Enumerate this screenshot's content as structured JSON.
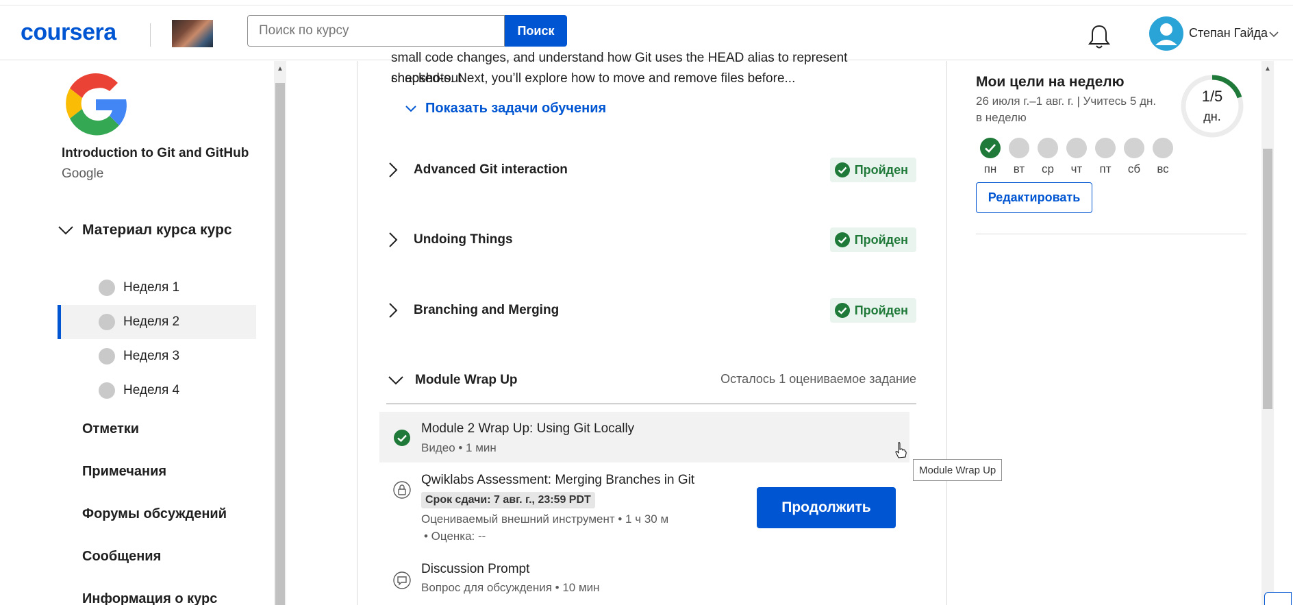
{
  "header": {
    "logo_text": "coursera",
    "search_placeholder": "Поиск по курсу",
    "search_button": "Поиск",
    "user_name": "Степан Гайда"
  },
  "sidebar": {
    "course_title": "Introduction to Git and GitHub",
    "course_org": "Google",
    "material_label": "Материал курса курс",
    "weeks": [
      {
        "label": "Неделя 1",
        "active": false
      },
      {
        "label": "Неделя 2",
        "active": true
      },
      {
        "label": "Неделя 3",
        "active": false
      },
      {
        "label": "Неделя 4",
        "active": false
      }
    ],
    "links": [
      "Отметки",
      "Примечания",
      "Форумы обсуждений",
      "Сообщения",
      "Информация о курс"
    ]
  },
  "main": {
    "cut_line1": "small code changes, and understand how Git uses the HEAD alias to represent checked-out",
    "cut_line2": "snapshots. Next, you’ll explore how to move and remove files before...",
    "show_tasks": "Показать задачи обучения",
    "modules": [
      {
        "title": "Advanced Git interaction",
        "status": "Пройден"
      },
      {
        "title": "Undoing Things",
        "status": "Пройден"
      },
      {
        "title": "Branching and Merging",
        "status": "Пройден"
      }
    ],
    "wrap_up": {
      "title": "Module Wrap Up",
      "remaining": "Осталось 1 оцениваемое задание"
    },
    "items": [
      {
        "name": "Module 2 Wrap Up: Using Git Locally",
        "meta": "Видео • 1 мин"
      },
      {
        "name": "Qwiklabs Assessment: Merging Branches in Git",
        "deadline": "Срок сдачи: 7 авг. г., 23:59 PDT",
        "meta": "Оцениваемый внешний инструмент • 1 ч 30 м",
        "meta2": "• Оценка: --"
      },
      {
        "name": "Discussion Prompt",
        "meta": "Вопрос для обсуждения • 10 мин"
      }
    ],
    "continue_button": "Продолжить",
    "tooltip": "Module Wrap Up"
  },
  "goals": {
    "title": "Мои цели на неделю",
    "subtitle": "26 июля г.–1 авг. г. | Учитесь 5 дн. в неделю",
    "progress": "1/5",
    "progress_value": 0.2,
    "unit": "дн.",
    "days": [
      {
        "label": "пн",
        "done": true
      },
      {
        "label": "вт",
        "done": false
      },
      {
        "label": "ср",
        "done": false
      },
      {
        "label": "чт",
        "done": false
      },
      {
        "label": "пт",
        "done": false
      },
      {
        "label": "сб",
        "done": false
      },
      {
        "label": "вс",
        "done": false
      }
    ],
    "edit_button": "Редактировать"
  },
  "colors": {
    "brand": "#0056d2",
    "success": "#1f7a3a",
    "success_bg": "#eaf4ee"
  }
}
